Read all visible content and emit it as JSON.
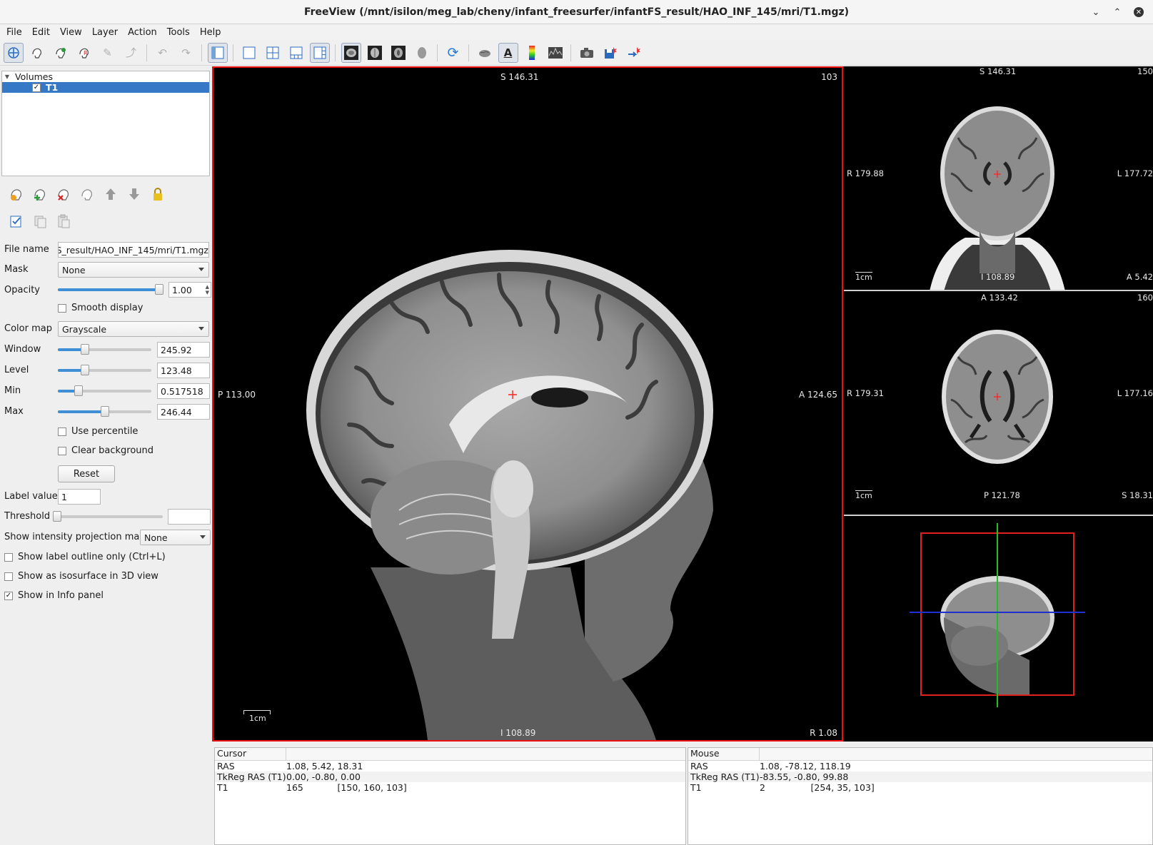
{
  "window": {
    "title": "FreeView (/mnt/isilon/meg_lab/cheny/infant_freesurfer/infantFS_result/HAO_INF_145/mri/T1.mgz)"
  },
  "menu": [
    "File",
    "Edit",
    "View",
    "Layer",
    "Action",
    "Tools",
    "Help"
  ],
  "toolbar": {
    "icons": [
      "navigate-icon",
      "voxel-edit-icon",
      "recon-edit-icon",
      "roi-edit-icon",
      "point-set-edit-icon",
      "contour-icon",
      "undo-icon",
      "redo-icon",
      "toggle-panel-icon",
      "layout-1x1-icon",
      "layout-2x2-icon",
      "layout-1-3-icon",
      "layout-1-3h-icon",
      "view-sagittal-icon",
      "view-coronal-icon",
      "view-axial-icon",
      "view-3d-icon",
      "reset-view-icon",
      "surface-icon",
      "text-annotation-icon",
      "color-bar-icon",
      "histogram-icon",
      "screenshot-icon",
      "save-icon",
      "transform-icon"
    ]
  },
  "layers": {
    "group": "Volumes",
    "items": [
      {
        "name": "T1",
        "checked": true
      }
    ]
  },
  "props": {
    "file_name_label": "File name",
    "file_name": "FS_result/HAO_INF_145/mri/T1.mgz",
    "mask_label": "Mask",
    "mask": "None",
    "opacity_label": "Opacity",
    "opacity": "1.00",
    "opacity_level": 1.0,
    "smooth_display": "Smooth display",
    "color_map_label": "Color map",
    "color_map": "Grayscale",
    "window_label": "Window",
    "window": "245.92",
    "window_level": 0.27,
    "level_label": "Level",
    "level": "123.48",
    "level_level": 0.27,
    "min_label": "Min",
    "min": "0.517518",
    "min_level": 0.19,
    "max_label": "Max",
    "max": "246.44",
    "max_level": 0.5,
    "use_percentile": "Use percentile",
    "clear_background": "Clear background",
    "reset": "Reset",
    "label_value_label": "Label value",
    "label_value": "1",
    "threshold_label": "Threshold",
    "threshold": "",
    "projection_label": "Show intensity projection map",
    "projection": "None",
    "show_label_outline": "Show label outline only (Ctrl+L)",
    "show_isosurface": "Show as isosurface in 3D view",
    "show_in_info": "Show in Info panel"
  },
  "main_view": {
    "top": "S 146.31",
    "slice": "103",
    "left": "P 113.00",
    "right": "A 124.65",
    "bottom": "I 108.89",
    "bottom_right": "R 1.08",
    "scale": "1cm"
  },
  "coronal_view": {
    "top": "S 146.31",
    "slice": "150",
    "left": "R 179.88",
    "right": "L 177.72",
    "bottom": "I 108.89",
    "bottom_right": "A 5.42",
    "scale": "1cm"
  },
  "axial_view": {
    "top": "A 133.42",
    "slice": "160",
    "left": "R 179.31",
    "right": "L 177.16",
    "bottom": "P 121.78",
    "bottom_right": "S 18.31",
    "scale": "1cm"
  },
  "cursor_info": {
    "header": "Cursor",
    "rows": [
      {
        "k": "RAS",
        "v": "1.08, 5.42, 18.31"
      },
      {
        "k": "TkReg RAS (T1)",
        "v": "0.00, -0.80, 0.00"
      },
      {
        "k": "T1",
        "v": "165            [150, 160, 103]"
      }
    ]
  },
  "mouse_info": {
    "header": "Mouse",
    "rows": [
      {
        "k": "RAS",
        "v": "1.08, -78.12, 118.19"
      },
      {
        "k": "TkReg RAS (T1)",
        "v": "-83.55, -0.80, 99.88"
      },
      {
        "k": "T1",
        "v": "2                [254, 35, 103]"
      }
    ]
  },
  "colors": {
    "accent": "#3478c6",
    "active_view_border": "#ee1111",
    "cursor": "#ff2020"
  }
}
